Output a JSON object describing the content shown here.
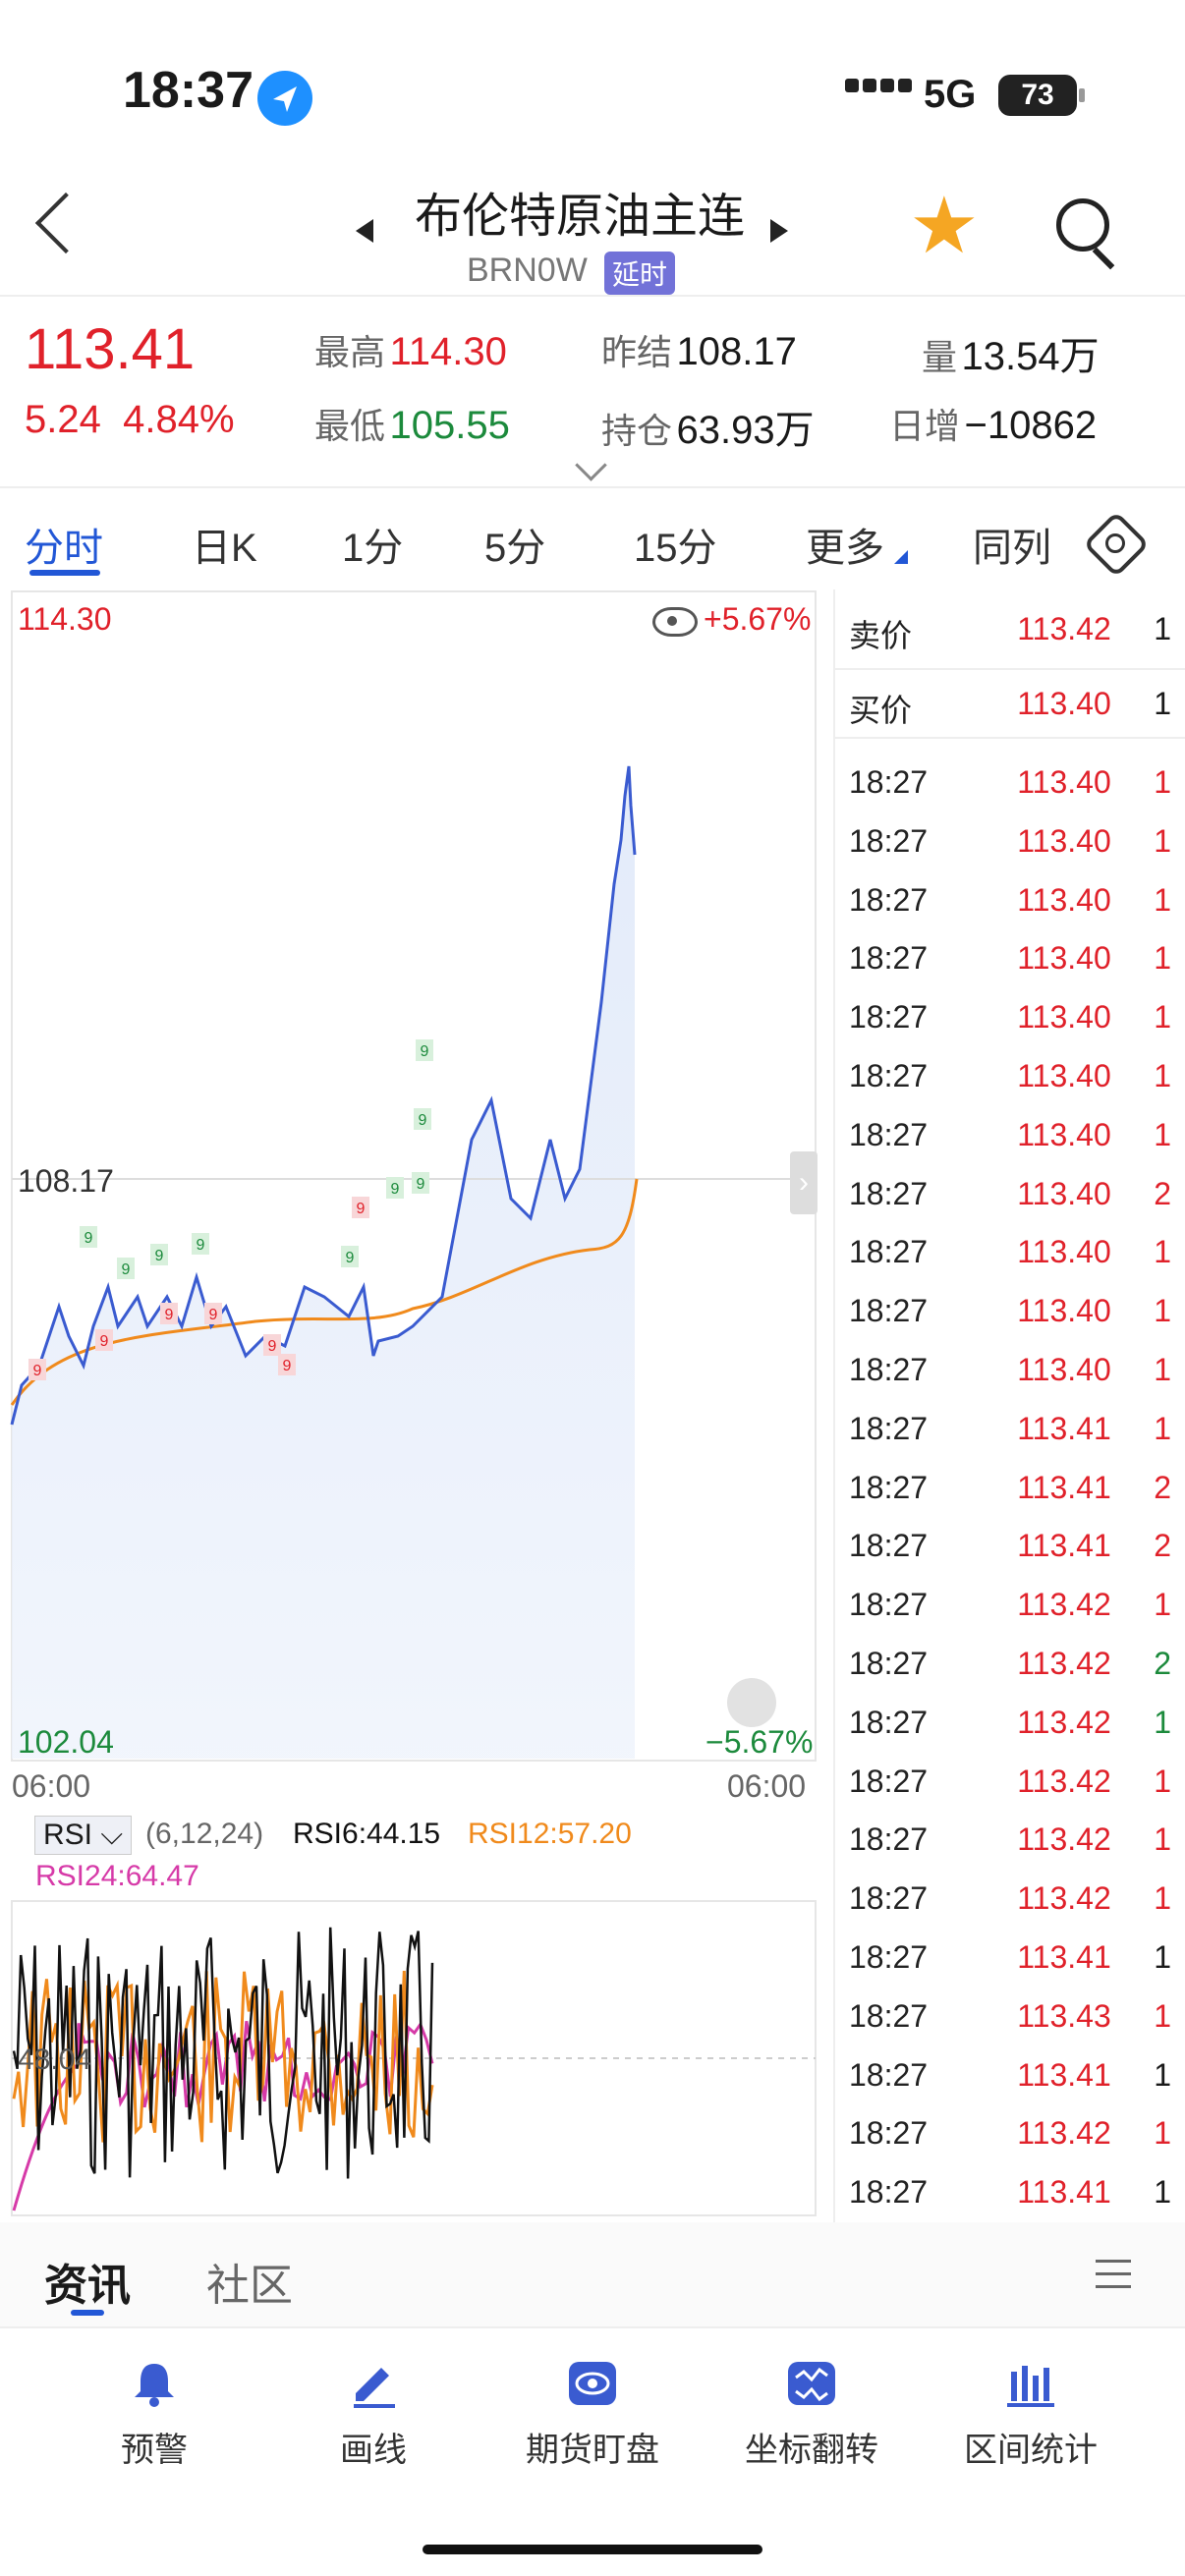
{
  "status": {
    "time": "18:37",
    "network": "5G",
    "battery": "73"
  },
  "header": {
    "title": "布伦特原油主连",
    "code": "BRN0W",
    "delay_badge": "延时"
  },
  "quote": {
    "last": "113.41",
    "change": "5.24",
    "change_pct": "4.84%",
    "high_label": "最高",
    "high": "114.30",
    "low_label": "最低",
    "low": "105.55",
    "prev_settle_label": "昨结",
    "prev_settle": "108.17",
    "open_interest_label": "持仓",
    "open_interest": "63.93万",
    "volume_label": "量",
    "volume": "13.54万",
    "daily_inc_label": "日增",
    "daily_inc": "−10862"
  },
  "tabs": [
    "分时",
    "日K",
    "1分",
    "5分",
    "15分",
    "更多",
    "同列"
  ],
  "chart": {
    "y_top": "114.30",
    "y_bottom": "102.04",
    "ref_price": "108.17",
    "pct_top": "+5.67%",
    "pct_bottom": "−5.67%",
    "x_left": "06:00",
    "x_right": "06:00",
    "rsi_ref": "48.04",
    "signal_mark": "9"
  },
  "rsi": {
    "selector": "RSI",
    "params": "(6,12,24)",
    "rsi6": "RSI6:44.15",
    "rsi12": "RSI12:57.20",
    "rsi24": "RSI24:64.47"
  },
  "colors": {
    "up": "#e0212a",
    "down": "#1c8a3c",
    "price_line": "#3a5bd0",
    "avg_line": "#f08a1c",
    "rsi6": "#111111",
    "rsi12": "#f08a1c",
    "rsi24": "#d63aa8"
  },
  "order_book": {
    "ask_label": "卖价",
    "ask_price": "113.42",
    "ask_vol": "1",
    "bid_label": "买价",
    "bid_price": "113.40",
    "bid_vol": "1",
    "trades": [
      {
        "time": "18:27",
        "price": "113.40",
        "vol": "1",
        "dir": "up"
      },
      {
        "time": "18:27",
        "price": "113.40",
        "vol": "1",
        "dir": "up"
      },
      {
        "time": "18:27",
        "price": "113.40",
        "vol": "1",
        "dir": "up"
      },
      {
        "time": "18:27",
        "price": "113.40",
        "vol": "1",
        "dir": "up"
      },
      {
        "time": "18:27",
        "price": "113.40",
        "vol": "1",
        "dir": "up"
      },
      {
        "time": "18:27",
        "price": "113.40",
        "vol": "1",
        "dir": "up"
      },
      {
        "time": "18:27",
        "price": "113.40",
        "vol": "1",
        "dir": "up"
      },
      {
        "time": "18:27",
        "price": "113.40",
        "vol": "2",
        "dir": "up"
      },
      {
        "time": "18:27",
        "price": "113.40",
        "vol": "1",
        "dir": "up"
      },
      {
        "time": "18:27",
        "price": "113.40",
        "vol": "1",
        "dir": "up"
      },
      {
        "time": "18:27",
        "price": "113.40",
        "vol": "1",
        "dir": "up"
      },
      {
        "time": "18:27",
        "price": "113.41",
        "vol": "1",
        "dir": "up"
      },
      {
        "time": "18:27",
        "price": "113.41",
        "vol": "2",
        "dir": "up"
      },
      {
        "time": "18:27",
        "price": "113.41",
        "vol": "2",
        "dir": "up"
      },
      {
        "time": "18:27",
        "price": "113.42",
        "vol": "1",
        "dir": "up"
      },
      {
        "time": "18:27",
        "price": "113.42",
        "vol": "2",
        "dir": "down"
      },
      {
        "time": "18:27",
        "price": "113.42",
        "vol": "1",
        "dir": "down"
      },
      {
        "time": "18:27",
        "price": "113.42",
        "vol": "1",
        "dir": "up"
      },
      {
        "time": "18:27",
        "price": "113.42",
        "vol": "1",
        "dir": "up"
      },
      {
        "time": "18:27",
        "price": "113.42",
        "vol": "1",
        "dir": "up"
      },
      {
        "time": "18:27",
        "price": "113.41",
        "vol": "1",
        "dir": "neutral"
      },
      {
        "time": "18:27",
        "price": "113.43",
        "vol": "1",
        "dir": "up"
      },
      {
        "time": "18:27",
        "price": "113.41",
        "vol": "1",
        "dir": "neutral"
      },
      {
        "time": "18:27",
        "price": "113.42",
        "vol": "1",
        "dir": "up"
      },
      {
        "time": "18:27",
        "price": "113.41",
        "vol": "1",
        "dir": "neutral"
      }
    ]
  },
  "news_tabs": {
    "news": "资讯",
    "community": "社区"
  },
  "toolbar": [
    {
      "label": "预警",
      "icon": "bell-icon"
    },
    {
      "label": "画线",
      "icon": "pen-icon"
    },
    {
      "label": "期货盯盘",
      "icon": "eye-icon"
    },
    {
      "label": "坐标翻转",
      "icon": "flip-icon"
    },
    {
      "label": "区间统计",
      "icon": "stats-icon"
    }
  ]
}
